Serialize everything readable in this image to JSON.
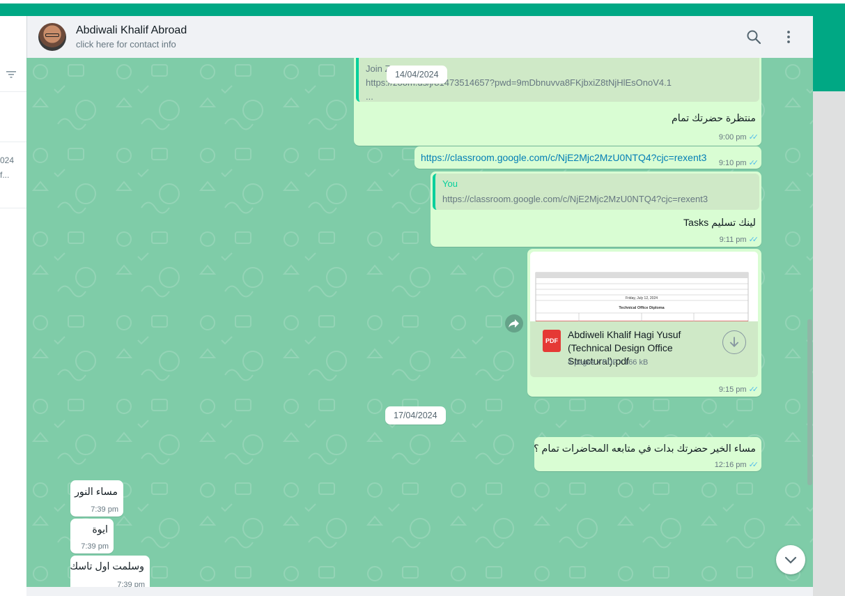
{
  "header": {
    "contact_name": "Abdiwali Khalif Abroad",
    "contact_sub": "click here for contact info",
    "search_icon": "search-icon",
    "menu_icon": "kebab-menu-icon"
  },
  "left_panel": {
    "date_snippet": "024",
    "text_snippet": "f..."
  },
  "messages": {
    "m1": {
      "quote_line1": "Join Z",
      "quote_line2": "https://zoom.us/j/81473514657?pwd=9mDbnuvva8FKjbxiZ8tNjHlEsOnoV4.1",
      "quote_line3": "...",
      "text": "منتظرة حضرتك تمام",
      "time": "9:00 pm"
    },
    "m2": {
      "text": "https://classroom.google.com/c/NjE2Mjc2MzU0NTQ4?cjc=rexent3",
      "time": "9:10 pm"
    },
    "m3": {
      "quote_name": "You",
      "quote_text": "https://classroom.google.com/c/NjE2Mjc2MzU0NTQ4?cjc=rexent3",
      "text": "لينك تسليم Tasks",
      "time": "9:11 pm"
    },
    "m4": {
      "doc_name": "Abdiweli Khalif Hagi Yusuf (Technical Design Office Structural).pdf",
      "doc_meta": "4 pages • PDF • 166 kB",
      "pdf_label": "PDF",
      "thumb_caption": "Technical Office Diploma",
      "thumb_date": "Friday, July 12, 2024",
      "time": "9:15 pm"
    },
    "m5": {
      "text": "مساء الخير حضرتك بدات في متابعه المحاضرات تمام ؟",
      "time": "12:16 pm"
    },
    "m6": {
      "text": "مساء النور",
      "time": "7:39 pm"
    },
    "m7": {
      "text": "ايوة",
      "time": "7:39 pm"
    },
    "m8": {
      "text": "وسلمت اول تاسك",
      "time": "7:39 pm"
    }
  },
  "dates": {
    "d1": "14/04/2024",
    "d2": "17/04/2024"
  },
  "ticks": "✓✓",
  "colors": {
    "accent": "#00a884",
    "chat_bg": "#7fcca8",
    "outgoing": "#d9fdd3",
    "incoming": "#ffffff",
    "tick_blue": "#53bdeb"
  }
}
